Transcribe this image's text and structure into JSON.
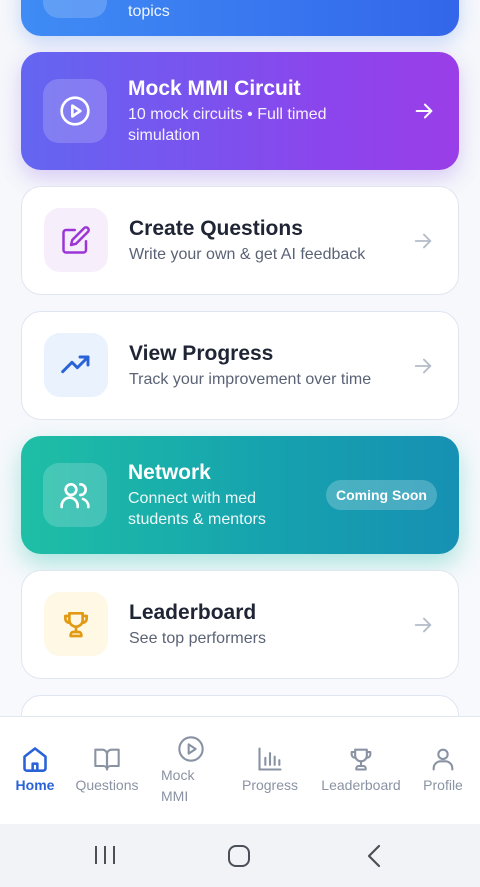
{
  "colors": {
    "accent": "#2a62d8",
    "nav_inactive": "#8a93a3",
    "blue_card": "#3f8cf5",
    "purple_card": "#8b45ec",
    "teal_card": "#1fbfa6"
  },
  "cards": {
    "top": {
      "sub": "topics"
    },
    "mock": {
      "title": "Mock MMI Circuit",
      "sub": "10 mock circuits • Full timed simulation",
      "icon": "play-circle-icon"
    },
    "create": {
      "title": "Create Questions",
      "sub": "Write your own & get AI feedback",
      "icon": "edit-icon"
    },
    "progress": {
      "title": "View Progress",
      "sub": "Track your improvement over time",
      "icon": "trending-up-icon"
    },
    "network": {
      "title": "Network",
      "sub": "Connect with med students & mentors",
      "badge": "Coming Soon",
      "icon": "users-icon"
    },
    "leader": {
      "title": "Leaderboard",
      "sub": "See top performers",
      "icon": "trophy-icon"
    }
  },
  "nav": {
    "items": [
      {
        "label": "Home",
        "icon": "home-icon",
        "active": true
      },
      {
        "label": "Questions",
        "icon": "book-icon",
        "active": false
      },
      {
        "label": "Mock\nMMI",
        "icon": "play-circle-icon",
        "active": false
      },
      {
        "label": "Progress",
        "icon": "bar-chart-icon",
        "active": false
      },
      {
        "label": "Leaderboard",
        "icon": "trophy-icon",
        "active": false
      },
      {
        "label": "Profile",
        "icon": "user-icon",
        "active": false
      }
    ]
  },
  "system_nav": {
    "buttons": [
      "recents-icon",
      "home-circle-icon",
      "back-icon"
    ]
  }
}
